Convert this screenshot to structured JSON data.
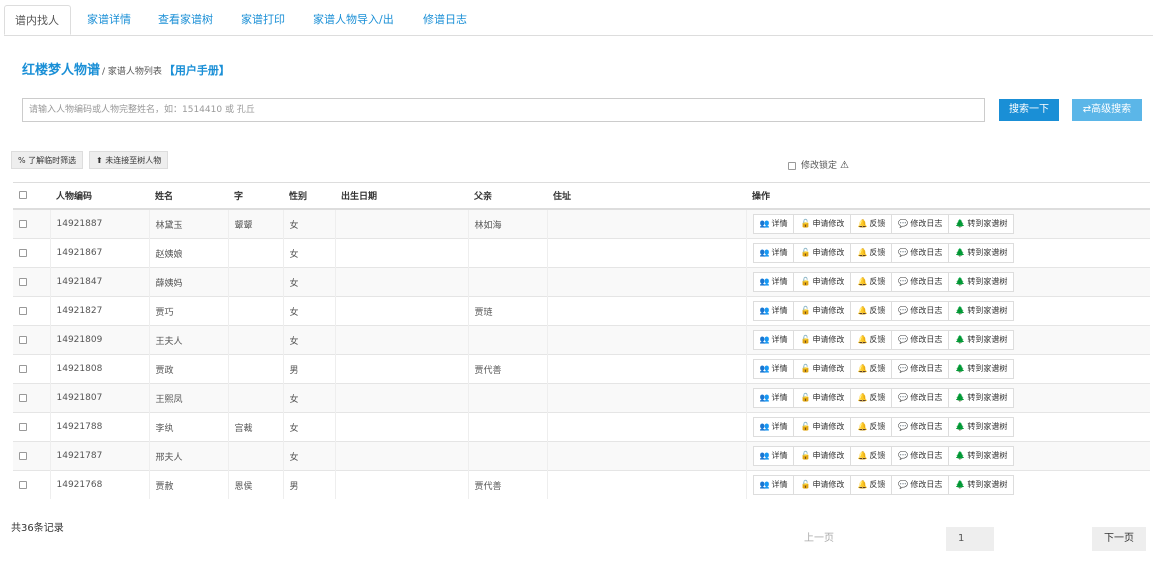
{
  "tabs": [
    {
      "label": "谱内找人"
    },
    {
      "label": "家谱详情"
    },
    {
      "label": "查看家谱树"
    },
    {
      "label": "家谱打印"
    },
    {
      "label": "家谱人物导入/出"
    },
    {
      "label": "修谱日志"
    }
  ],
  "header": {
    "title": "红楼梦人物谱",
    "subtitle": "/ 家谱人物列表",
    "manual_link": "【用户手册】"
  },
  "search": {
    "placeholder": "请输入人物编码或人物完整姓名，如：1514410 或 孔丘",
    "search_button": "搜索一下",
    "advanced_button": "⇄高级搜索"
  },
  "toolbar": {
    "temp_button": "% 了解临时筛选",
    "unlinked_button": "⬆ 未连接至树人物",
    "lock_label": "修改锁定",
    "warning_icon": "⚠"
  },
  "table": {
    "headers": [
      "",
      "人物编码",
      "姓名",
      "字",
      "性别",
      "出生日期",
      "父亲",
      "住址",
      "操作"
    ],
    "rows": [
      {
        "id": "14921887",
        "name": "林黛玉",
        "zi": "颦颦",
        "gender": "女",
        "birth": "",
        "father": "林如海",
        "address": ""
      },
      {
        "id": "14921867",
        "name": "赵姨娘",
        "zi": "",
        "gender": "女",
        "birth": "",
        "father": "",
        "address": ""
      },
      {
        "id": "14921847",
        "name": "薛姨妈",
        "zi": "",
        "gender": "女",
        "birth": "",
        "father": "",
        "address": ""
      },
      {
        "id": "14921827",
        "name": "贾巧",
        "zi": "",
        "gender": "女",
        "birth": "",
        "father": "贾琏",
        "address": ""
      },
      {
        "id": "14921809",
        "name": "王夫人",
        "zi": "",
        "gender": "女",
        "birth": "",
        "father": "",
        "address": ""
      },
      {
        "id": "14921808",
        "name": "贾政",
        "zi": "",
        "gender": "男",
        "birth": "",
        "father": "贾代善",
        "address": ""
      },
      {
        "id": "14921807",
        "name": "王熙凤",
        "zi": "",
        "gender": "女",
        "birth": "",
        "father": "",
        "address": ""
      },
      {
        "id": "14921788",
        "name": "李纨",
        "zi": "宫裁",
        "gender": "女",
        "birth": "",
        "father": "",
        "address": ""
      },
      {
        "id": "14921787",
        "name": "邢夫人",
        "zi": "",
        "gender": "女",
        "birth": "",
        "father": "",
        "address": ""
      },
      {
        "id": "14921768",
        "name": "贾赦",
        "zi": "恩侯",
        "gender": "男",
        "birth": "",
        "father": "贾代善",
        "address": ""
      }
    ],
    "actions": [
      {
        "icon": "users-icon",
        "glyph": "👥",
        "label": "详情"
      },
      {
        "icon": "unlock-icon",
        "glyph": "🔓",
        "label": "申请修改"
      },
      {
        "icon": "bell-icon",
        "glyph": "🔔",
        "label": "反馈"
      },
      {
        "icon": "comment-icon",
        "glyph": "💬",
        "label": "修改日志"
      },
      {
        "icon": "tree-icon",
        "glyph": "🌲",
        "label": "转到家谱树"
      }
    ]
  },
  "footer": {
    "total": "共36条记录",
    "prev": "上一页",
    "page": "1",
    "next": "下一页"
  }
}
